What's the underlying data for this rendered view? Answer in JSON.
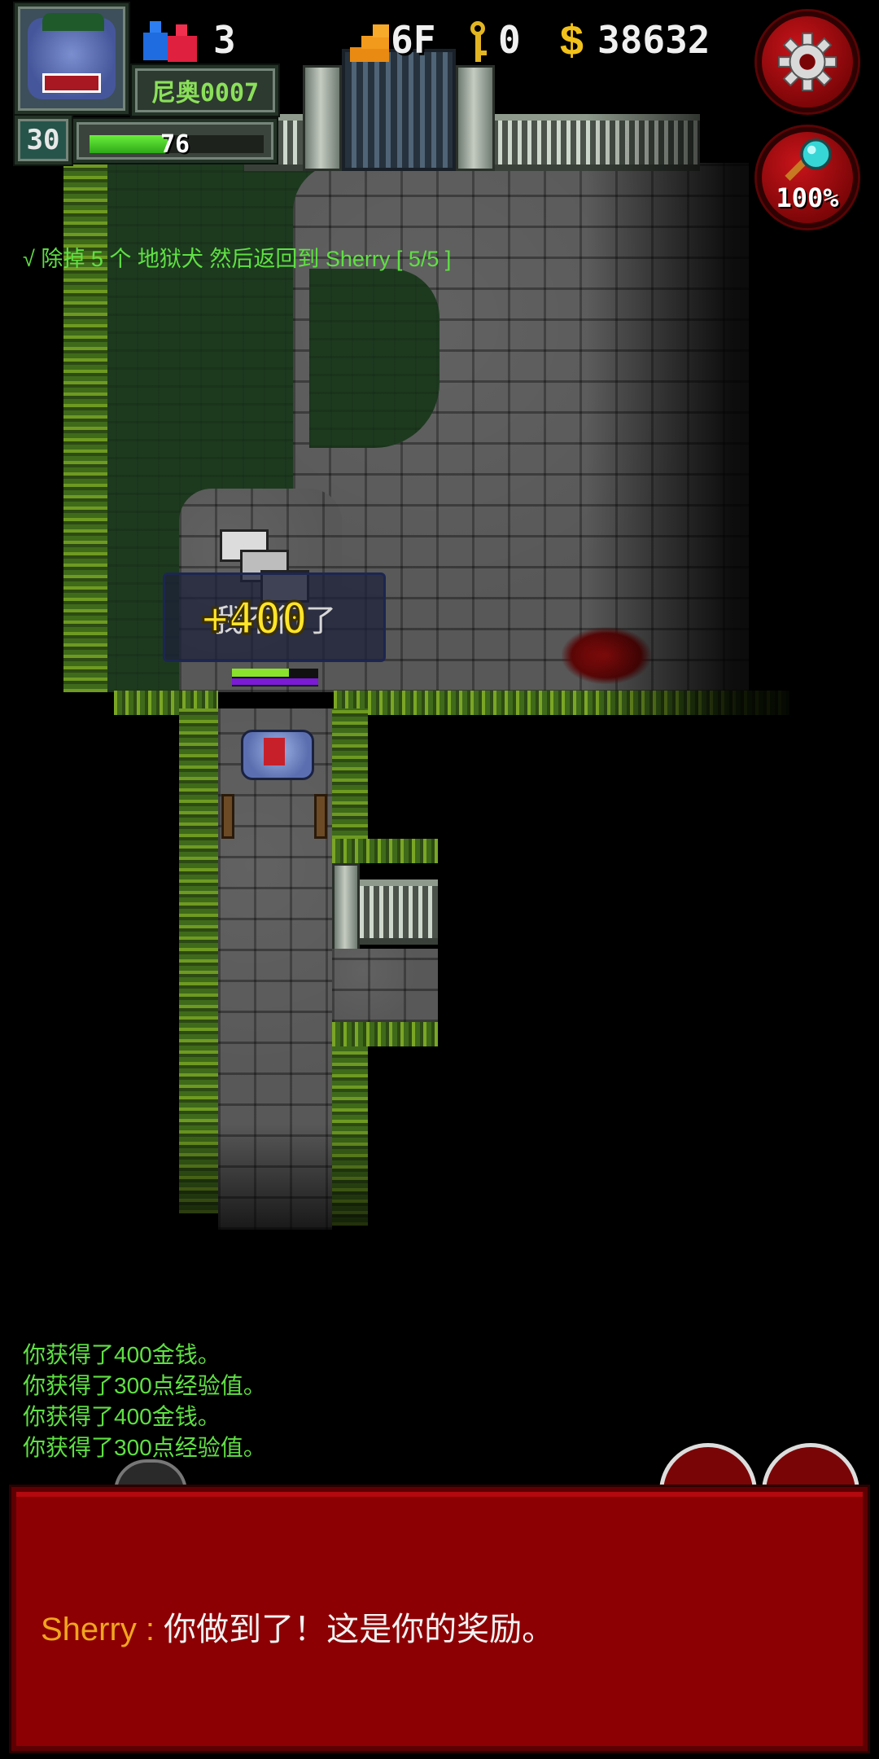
{
  "hud": {
    "hero_name": "尼奥0007",
    "level": "30",
    "hp_value": "76",
    "hp_fraction": 0.45,
    "strength_value": "3",
    "floor": "6F",
    "keys": "0",
    "gold": "38632",
    "zoom": "100%",
    "icons": {
      "strength": "strength-potion-icon",
      "floor": "stairs-icon",
      "key": "key-icon",
      "gold": "dollar-icon",
      "settings": "gear-icon",
      "zoom": "magnifier-icon"
    }
  },
  "quest": {
    "text": "√  除掉 5 个 地狱犬 然后返回到 Sherry [ 5/5 ]"
  },
  "world": {
    "bubble_text": "我不行了",
    "float_text": "+400"
  },
  "log": [
    "你获得了400金钱。",
    "你获得了300点经验值。",
    "你获得了400金钱。",
    "你获得了300点经验值。"
  ],
  "dialog": {
    "speaker": "Sherry",
    "separator": " : ",
    "text": "你做到了！这是你的奖励。"
  },
  "colors": {
    "log_green": "#5fe043",
    "dialog_bg": "#8c0004",
    "speaker_orange": "#f0a51e",
    "gold_yellow": "#ffe52a"
  }
}
